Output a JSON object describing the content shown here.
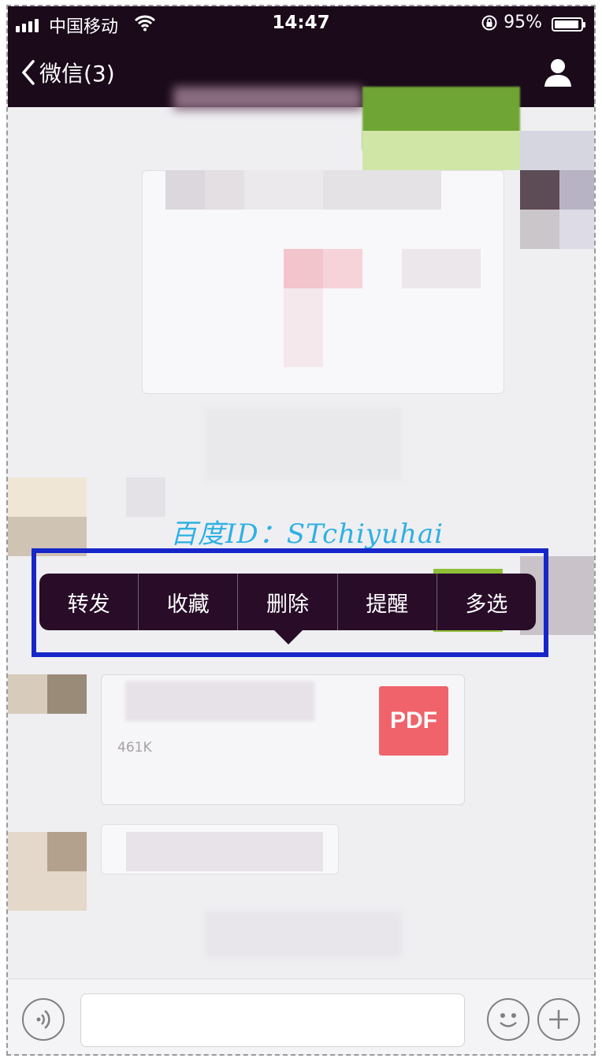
{
  "status_bar": {
    "carrier": "中国移动",
    "time": "14:47",
    "battery_text": "95%",
    "battery_level": 0.95
  },
  "nav": {
    "back_title": "微信(3)",
    "icons": [
      "chevron-left-icon",
      "profile-icon"
    ]
  },
  "watermark": "百度ID：STchiyuhai",
  "context_menu": {
    "items": [
      "转发",
      "收藏",
      "删除",
      "提醒",
      "多选"
    ]
  },
  "file_card": {
    "icon_label": "PDF",
    "size": "461K"
  },
  "input_bar": {
    "icons": [
      "voice-icon",
      "emoji-icon",
      "plus-icon"
    ]
  },
  "colors": {
    "nav_bg": "#1a0a1a",
    "menu_bg": "#280c28",
    "highlight": "#1726c8",
    "watermark": "#2fb0e3",
    "pdf": "#f0636b"
  }
}
